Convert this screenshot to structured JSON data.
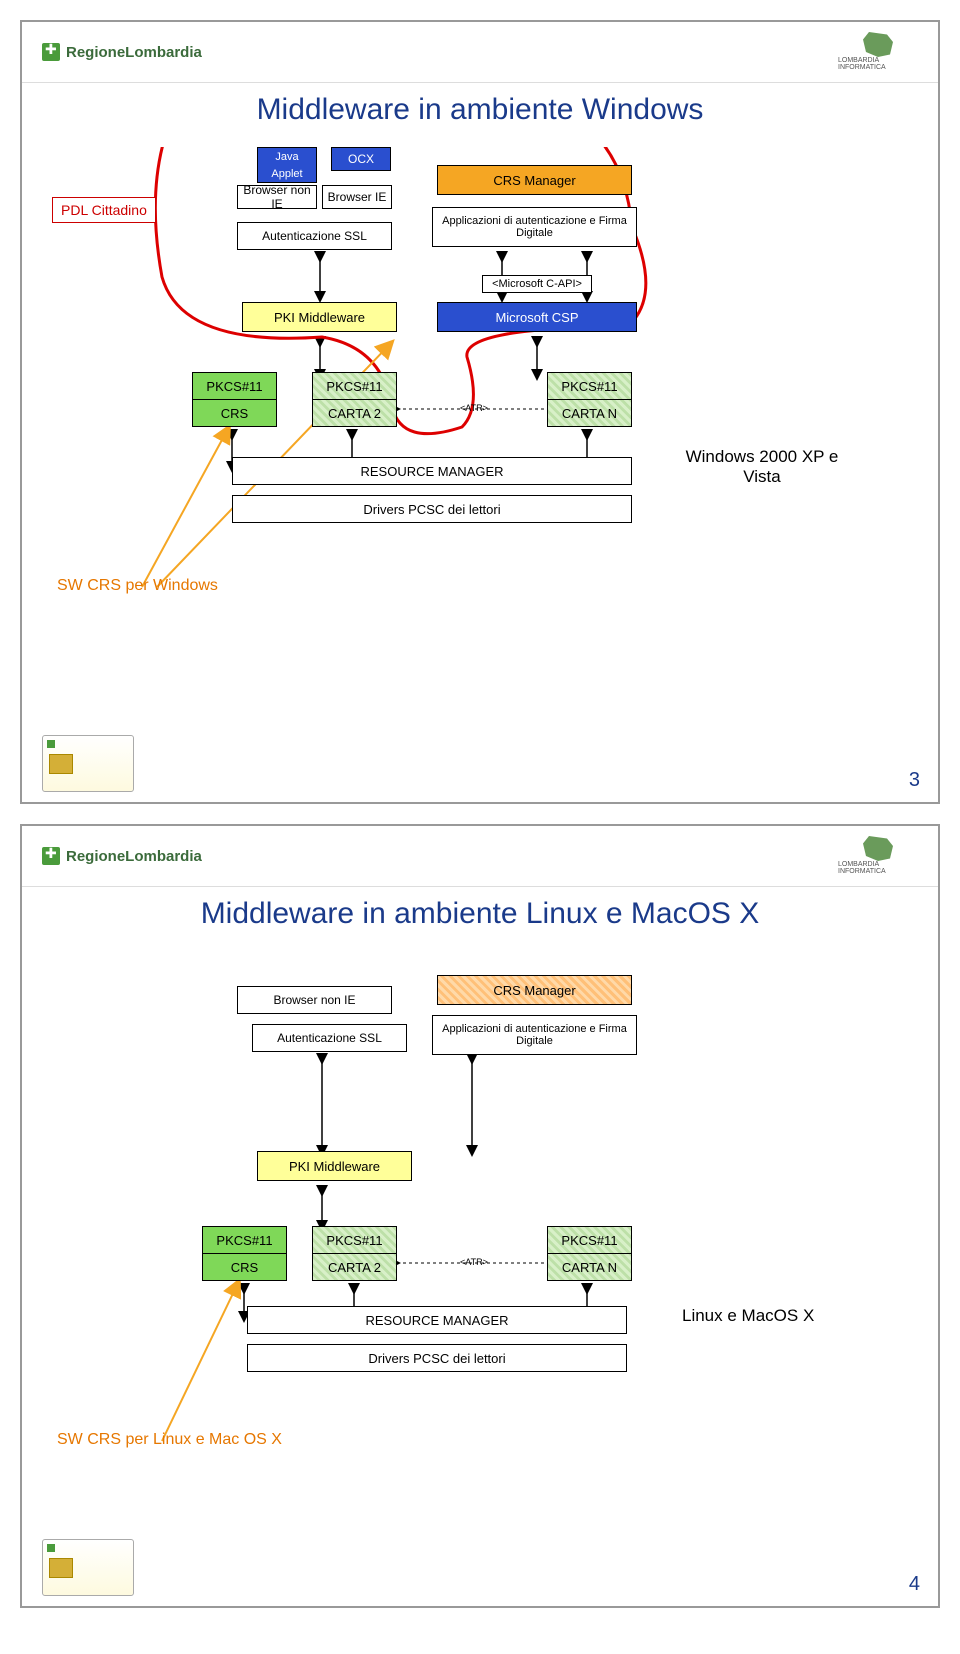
{
  "brand": "RegioneLombardia",
  "right_logo_text": "LOMBARDIA INFORMATICA",
  "slide1": {
    "title": "Middleware in ambiente Windows",
    "pdl": "PDL Cittadino",
    "java_applet": "Java Applet",
    "ocx": "OCX",
    "browser_non_ie": "Browser non IE",
    "browser_ie": "Browser IE",
    "auth_ssl": "Autenticazione SSL",
    "crs_manager": "CRS Manager",
    "apps": "Applicazioni di autenticazione e Firma Digitale",
    "capi": "<Microsoft C-API>",
    "pki": "PKI Middleware",
    "csp": "Microsoft CSP",
    "pkcs11": "PKCS#11",
    "crs": "CRS",
    "carta2": "CARTA 2",
    "atr": "<ATR>",
    "cartan": "CARTA N",
    "resmgr": "RESOURCE MANAGER",
    "drivers": "Drivers PCSC dei lettori",
    "os_note": "Windows 2000 XP e Vista",
    "sw_label": "SW CRS per Windows",
    "page": "3"
  },
  "slide2": {
    "title": "Middleware in ambiente Linux e MacOS X",
    "browser_non_ie": "Browser non IE",
    "auth_ssl": "Autenticazione SSL",
    "crs_manager": "CRS Manager",
    "apps": "Applicazioni di autenticazione e Firma Digitale",
    "pki": "PKI Middleware",
    "pkcs11": "PKCS#11",
    "crs": "CRS",
    "carta2": "CARTA 2",
    "atr": "<ATR>",
    "cartan": "CARTA N",
    "resmgr": "RESOURCE MANAGER",
    "drivers": "Drivers PCSC dei lettori",
    "os_note": "Linux e MacOS X",
    "sw_label": "SW CRS per Linux e Mac OS X",
    "page": "4"
  }
}
